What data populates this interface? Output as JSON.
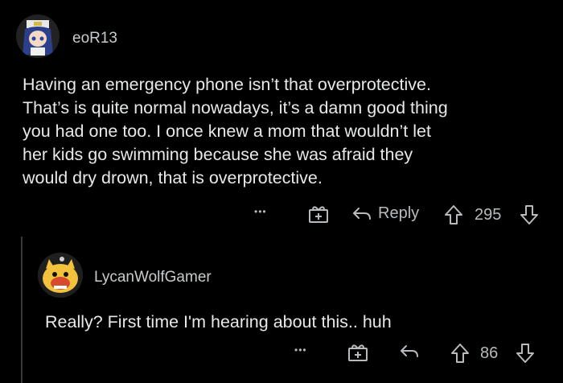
{
  "comment": {
    "username": "eoR13",
    "body": "Having an emergency phone isn’t that overprotective.\nThat’s is quite normal nowadays, it’s a damn good thing\nyou had one too.  I once knew a mom that wouldn’t let\nher kids go swimming because she was afraid they\nwould dry drown, that is overprotective.",
    "actions": {
      "more": "•••",
      "reply_label": "Reply",
      "score": "295"
    }
  },
  "reply": {
    "username": "LycanWolfGamer",
    "body": "Really? First time I'm hearing about this.. huh",
    "actions": {
      "more": "•••",
      "score": "86"
    }
  }
}
